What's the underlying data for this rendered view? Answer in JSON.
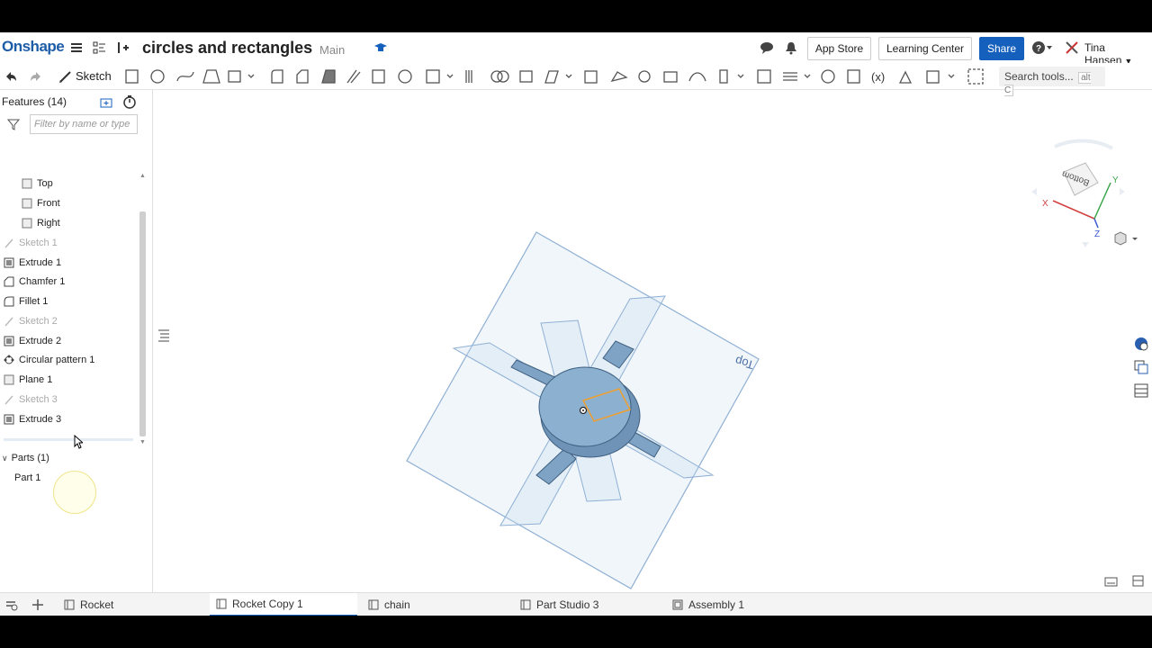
{
  "header": {
    "logo": "Onshape",
    "doc_title": "circles and rectangles",
    "branch": "Main",
    "app_store": "App Store",
    "learning_center": "Learning Center",
    "share": "Share",
    "user": "Tina Hansen"
  },
  "toolbar": {
    "sketch_label": "Sketch",
    "search_label": "Search tools...",
    "search_shortcut": "alt C"
  },
  "feature_panel": {
    "title": "Features (14)",
    "filter_placeholder": "Filter by name or type",
    "items": [
      {
        "label": "Top",
        "type": "plane",
        "dim": false
      },
      {
        "label": "Front",
        "type": "plane",
        "dim": false
      },
      {
        "label": "Right",
        "type": "plane",
        "dim": false
      },
      {
        "label": "Sketch 1",
        "type": "sketch",
        "dim": true
      },
      {
        "label": "Extrude 1",
        "type": "extrude",
        "dim": false
      },
      {
        "label": "Chamfer 1",
        "type": "chamfer",
        "dim": false
      },
      {
        "label": "Fillet 1",
        "type": "fillet",
        "dim": false
      },
      {
        "label": "Sketch 2",
        "type": "sketch",
        "dim": true
      },
      {
        "label": "Extrude 2",
        "type": "extrude",
        "dim": false
      },
      {
        "label": "Circular pattern 1",
        "type": "pattern",
        "dim": false
      },
      {
        "label": "Plane 1",
        "type": "plane",
        "dim": false
      },
      {
        "label": "Sketch 3",
        "type": "sketch",
        "dim": true
      },
      {
        "label": "Extrude 3",
        "type": "extrude",
        "dim": false
      }
    ],
    "parts_header": "Parts (1)",
    "parts": [
      "Part 1"
    ]
  },
  "view_cube": {
    "face_label": "Bottom",
    "x": "X",
    "y": "Y",
    "z": "Z"
  },
  "viewport": {
    "plane_label": "Top"
  },
  "tabs": [
    {
      "label": "Rocket",
      "active": false
    },
    {
      "label": "Rocket Copy 1",
      "active": true
    },
    {
      "label": "chain",
      "active": false
    },
    {
      "label": "Part Studio 3",
      "active": false
    },
    {
      "label": "Assembly 1",
      "active": false
    }
  ],
  "colors": {
    "brand": "#1d5ca8",
    "share": "#1560bd",
    "part_fill": "#7fa3c4",
    "selection": "#f0a030"
  }
}
